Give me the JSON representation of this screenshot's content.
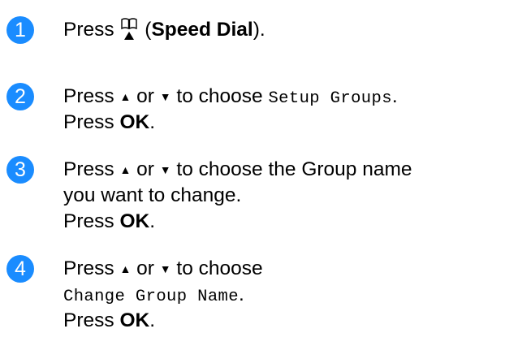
{
  "colors": {
    "badge": "#1a8cff",
    "text": "#000000"
  },
  "steps": [
    {
      "number": "1",
      "lines": [
        {
          "press": "Press",
          "icon": "book-up-arrow-icon",
          "open_paren": "(",
          "speed_dial": "Speed Dial",
          "close_paren": ")."
        }
      ]
    },
    {
      "number": "2",
      "line1": {
        "press": "Press",
        "up": "▲",
        "or": "or",
        "down": "▼",
        "to_choose": "to choose",
        "option": "Setup Groups",
        "period": "."
      },
      "line2": {
        "press": "Press",
        "ok": "OK",
        "period": "."
      }
    },
    {
      "number": "3",
      "line1": {
        "press": "Press",
        "up": "▲",
        "or": "or",
        "down": "▼",
        "rest": "to choose the Group name"
      },
      "line2": "you want to change.",
      "line3": {
        "press": "Press",
        "ok": "OK",
        "period": "."
      }
    },
    {
      "number": "4",
      "line1": {
        "press": "Press",
        "up": "▲",
        "or": "or",
        "down": "▼",
        "to_choose": "to choose"
      },
      "line2": {
        "option": "Change Group Name",
        "period": "."
      },
      "line3": {
        "press": "Press",
        "ok": "OK",
        "period": "."
      }
    }
  ]
}
